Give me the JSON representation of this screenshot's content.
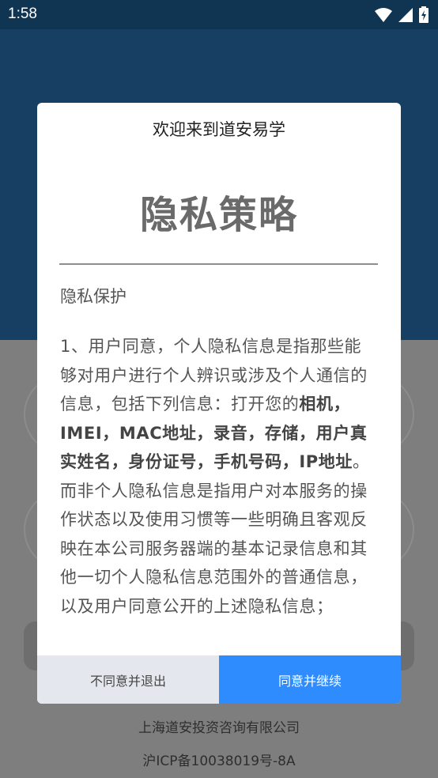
{
  "status_bar": {
    "time": "1:58",
    "icons": [
      "wifi-icon",
      "signal-icon",
      "battery-charging-icon"
    ]
  },
  "background": {
    "footer_company": "上海道安投资咨询有限公司",
    "footer_icp": "沪ICP备10038019号-8A"
  },
  "dialog": {
    "welcome": "欢迎来到道安易学",
    "title": "隐私策略",
    "section_heading": "隐私保护",
    "paragraph_parts": [
      {
        "text": "1、用户同意，个人隐私信息是指那些能够对用户进行个人辨识或涉及个人通信的信息，包括下列信息：打开您的",
        "bold": false
      },
      {
        "text": "相机，IMEI，MAC地址，录音，存储，用户真实姓名，身份证号，手机号码，IP地址",
        "bold": true
      },
      {
        "text": "。而非个人隐私信息是指用户对本服务的操作状态以及使用习惯等一些明确且客观反映在本公司服务器端的基本记录信息和其他一切个人隐私信息范围外的普通信息，以及用户同意公开的上述隐私信息；",
        "bold": false
      }
    ],
    "decline_label": "不同意并退出",
    "agree_label": "同意并继续"
  },
  "colors": {
    "status_bar": "#0f3553",
    "header_dimmed": "#163f63",
    "overlay_body": "#7e7e7e",
    "agree_button": "#2e8cff",
    "decline_button": "#e4e7ee"
  }
}
